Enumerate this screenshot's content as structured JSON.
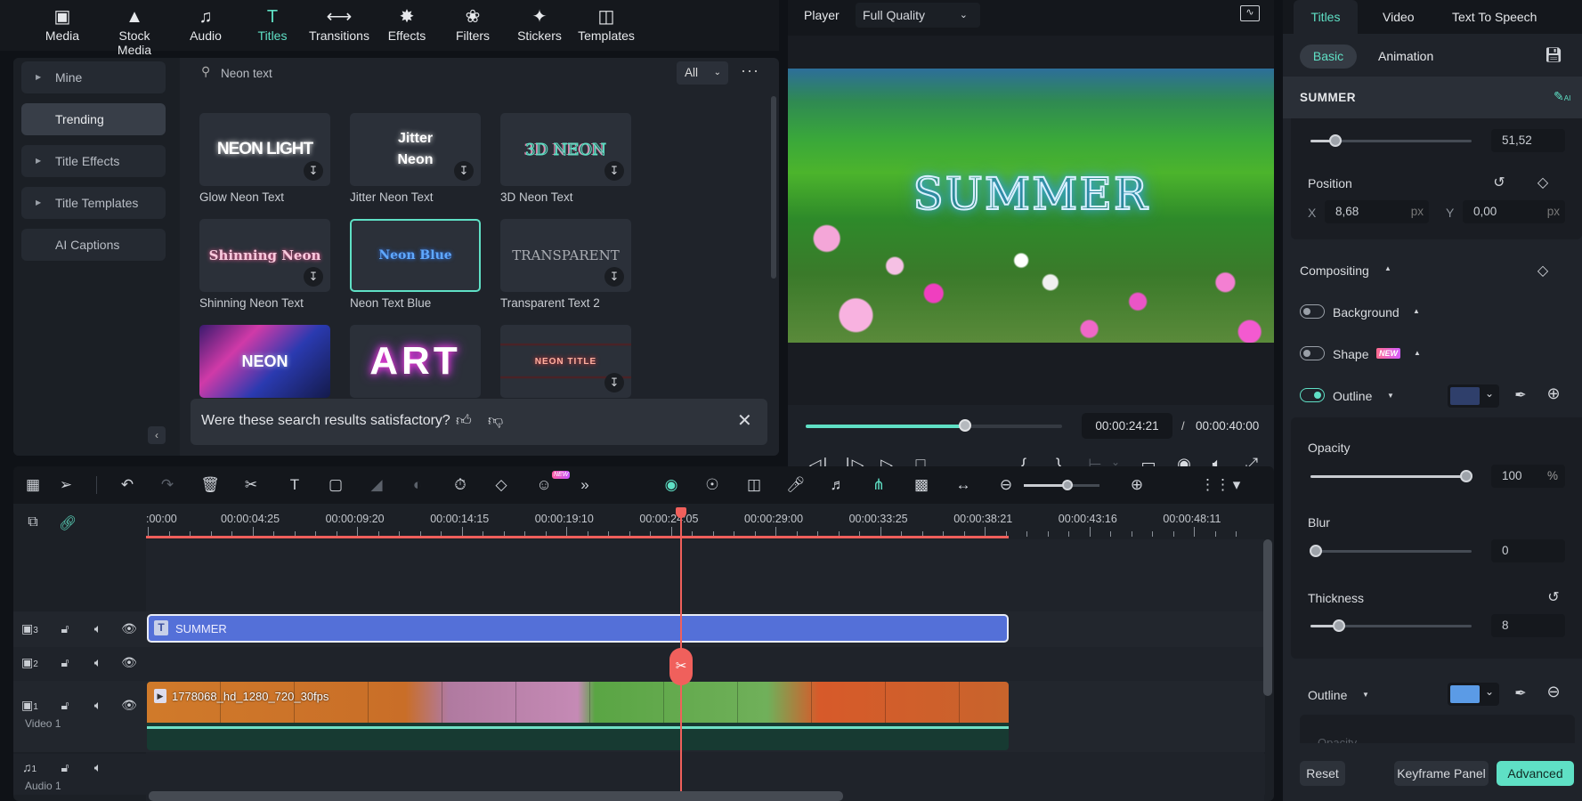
{
  "top_tabs": [
    {
      "label": "Media",
      "icon": "media-icon"
    },
    {
      "label": "Stock Media",
      "icon": "stock-media-icon"
    },
    {
      "label": "Audio",
      "icon": "music-note-icon"
    },
    {
      "label": "Titles",
      "icon": "title-t-icon",
      "active": true
    },
    {
      "label": "Transitions",
      "icon": "transitions-icon"
    },
    {
      "label": "Effects",
      "icon": "effects-icon"
    },
    {
      "label": "Filters",
      "icon": "filters-icon"
    },
    {
      "label": "Stickers",
      "icon": "stickers-icon"
    },
    {
      "label": "Templates",
      "icon": "templates-icon"
    }
  ],
  "sidebar": {
    "items": [
      {
        "label": "Mine",
        "expandable": true
      },
      {
        "label": "Trending",
        "active": true
      },
      {
        "label": "Title Effects",
        "expandable": true
      },
      {
        "label": "Title Templates",
        "expandable": true
      },
      {
        "label": "AI Captions"
      }
    ]
  },
  "search": {
    "value": "Neon text",
    "filter": "All"
  },
  "titles_grid": [
    {
      "label": "Glow Neon Text",
      "preview": "NEON LIGHT"
    },
    {
      "label": "Jitter Neon Text",
      "preview": "Jitter Neon"
    },
    {
      "label": "3D Neon Text",
      "preview": "3D NEON"
    },
    {
      "label": "Shinning Neon Text",
      "preview": "Shinning Neon"
    },
    {
      "label": "Neon Text Blue",
      "preview": "Neon Blue",
      "selected": true
    },
    {
      "label": "Transparent Text 2",
      "preview": "TRANSPARENT"
    },
    {
      "label": "",
      "preview": "NEON"
    },
    {
      "label": "",
      "preview": "ART"
    },
    {
      "label": "",
      "preview": "NEON TITLE"
    }
  ],
  "feedback": {
    "question": "Were these search results satisfactory?"
  },
  "player": {
    "label": "Player",
    "quality": "Full Quality",
    "overlay_text": "SUMMER",
    "current_time": "00:00:24:21",
    "total_time": "00:00:40:00",
    "separator": "/",
    "progress_fraction": 0.62
  },
  "timeline": {
    "ruler": [
      ":00:00",
      "00:00:04:25",
      "00:00:09:20",
      "00:00:14:15",
      "00:00:19:10",
      "00:00:24:05",
      "00:00:29:00",
      "00:00:33:25",
      "00:00:38:21",
      "00:00:43:16",
      "00:00:48:11"
    ],
    "new_badge": "NEW",
    "zoom_fraction": 0.58,
    "tracks": [
      {
        "id": "3",
        "type": "title"
      },
      {
        "id": "2",
        "type": "video"
      },
      {
        "id": "1",
        "type": "video",
        "name": "Video 1"
      },
      {
        "id": "1",
        "type": "audio",
        "name": "Audio 1"
      }
    ],
    "title_clip": "SUMMER",
    "video_clip": "1778068_hd_1280_720_30fps"
  },
  "right_panel": {
    "tabs": [
      "Titles",
      "Video",
      "Text To Speech"
    ],
    "active_tab": "Titles",
    "subtabs": [
      "Basic",
      "Animation"
    ],
    "clip_name": "SUMMER",
    "scale_value": "51,52",
    "position": {
      "label": "Position",
      "x_label": "X",
      "x": "8,68",
      "y_label": "Y",
      "y": "0,00",
      "unit": "px"
    },
    "compositing": "Compositing",
    "background": {
      "label": "Background",
      "on": false
    },
    "shape": {
      "label": "Shape",
      "badge": "NEW",
      "on": false
    },
    "outline": {
      "label": "Outline",
      "on": true,
      "color": "#2f3f6b"
    },
    "opacity": {
      "label": "Opacity",
      "value": "100",
      "unit": "%"
    },
    "blur": {
      "label": "Blur",
      "value": "0"
    },
    "thickness": {
      "label": "Thickness",
      "value": "8"
    },
    "outline2": {
      "label": "Outline",
      "color": "#5b9be6"
    },
    "faded_label": "Opacity",
    "buttons": {
      "reset": "Reset",
      "keyframe": "Keyframe Panel",
      "advanced": "Advanced"
    }
  },
  "colors": {
    "accent": "#5fe0c5",
    "playhead": "#f0605c",
    "title_clip": "#5470d8"
  }
}
